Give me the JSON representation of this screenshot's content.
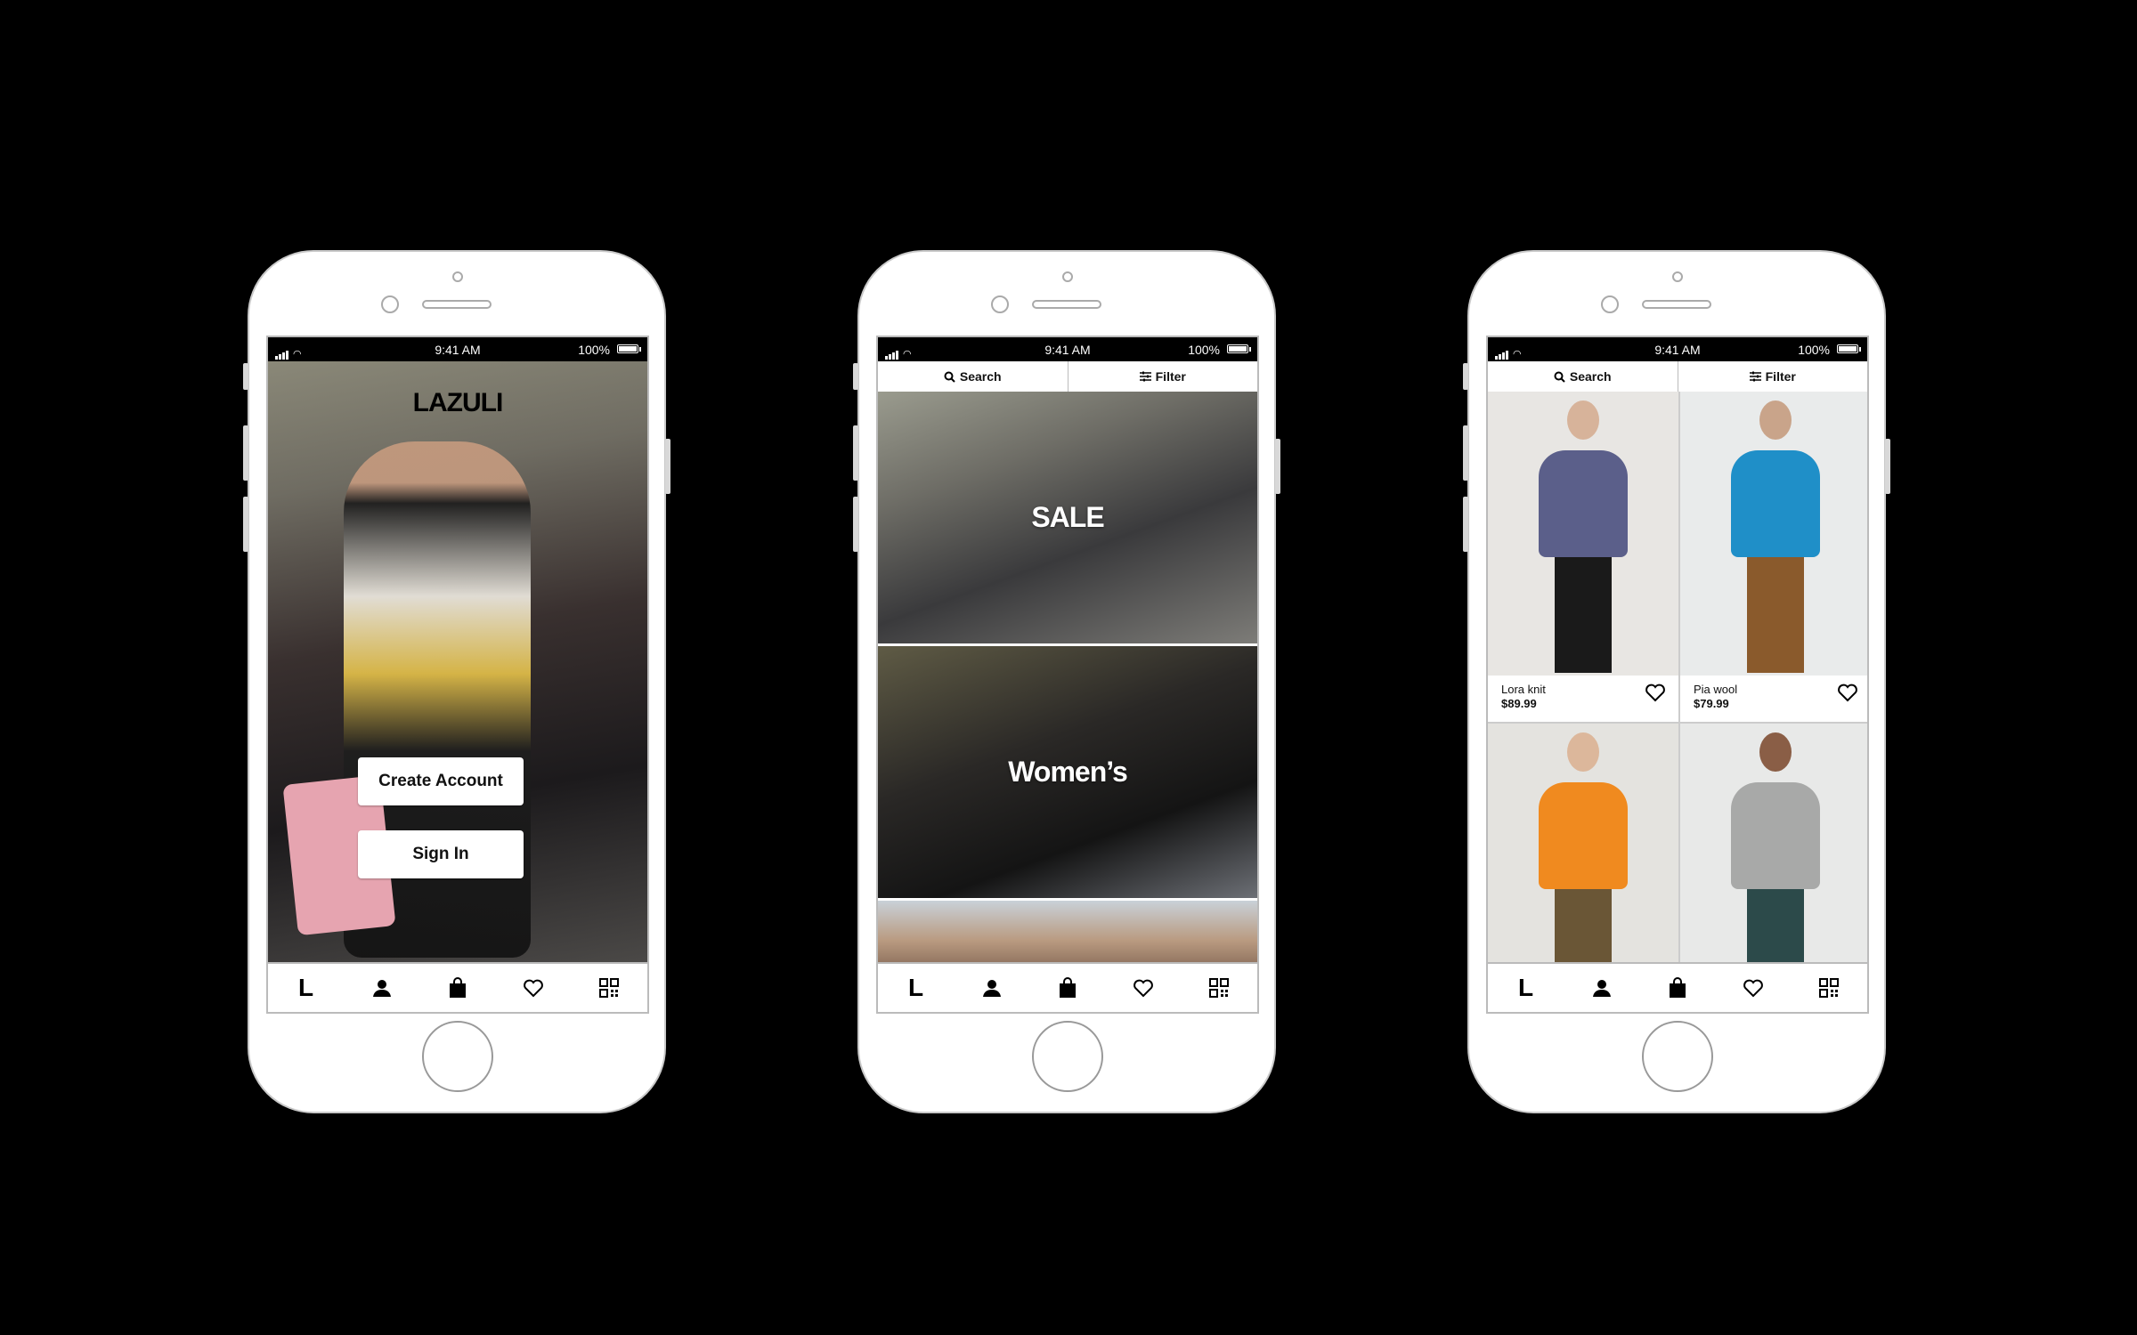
{
  "status_bar": {
    "time": "9:41 AM",
    "battery": "100%"
  },
  "phone1": {
    "brand": "LAZULI",
    "create_account": "Create Account",
    "sign_in": "Sign In"
  },
  "phone2": {
    "search_label": "Search",
    "filter_label": "Filter",
    "tiles": [
      {
        "label": "SALE"
      },
      {
        "label": "Women’s"
      },
      {
        "label": ""
      }
    ]
  },
  "phone3": {
    "search_label": "Search",
    "filter_label": "Filter",
    "products": [
      {
        "name": "Lora knit",
        "price": "$89.99",
        "top_color": "#5b5f8a",
        "bottom_color": "#1a1a1a"
      },
      {
        "name": "Pia wool",
        "price": "$79.99",
        "top_color": "#1f8fc8",
        "bottom_color": "#8a5a2c"
      },
      {
        "name": "",
        "price": "",
        "top_color": "#f08a1f",
        "bottom_color": "#6a5636"
      },
      {
        "name": "",
        "price": "",
        "top_color": "#a8a9a8",
        "bottom_color": "#2c4a4a"
      }
    ]
  },
  "tabbar": {
    "icons": [
      "logo-l-icon",
      "profile-icon",
      "bag-icon",
      "heart-icon",
      "qr-code-icon"
    ],
    "logo_letter": "L"
  }
}
